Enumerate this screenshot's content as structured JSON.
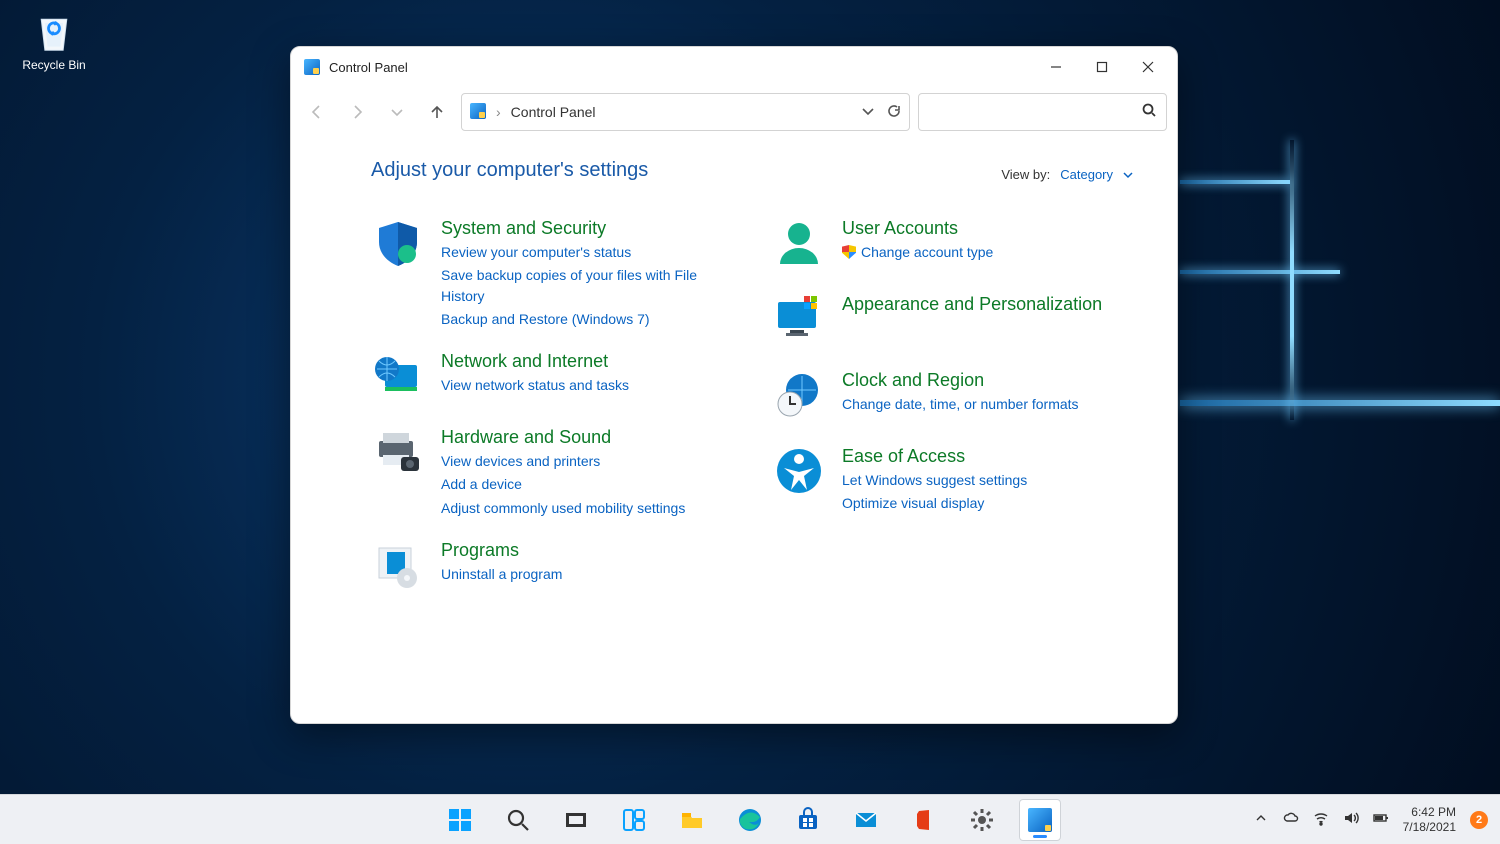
{
  "desktop": {
    "recycle_bin": "Recycle Bin"
  },
  "window": {
    "title": "Control Panel",
    "breadcrumb": "Control Panel",
    "search_placeholder": ""
  },
  "main": {
    "heading": "Adjust your computer's settings",
    "viewby_label": "View by:",
    "viewby_value": "Category"
  },
  "categories": {
    "left": [
      {
        "title": "System and Security",
        "links": [
          "Review your computer's status",
          "Save backup copies of your files with File History",
          "Backup and Restore (Windows 7)"
        ]
      },
      {
        "title": "Network and Internet",
        "links": [
          "View network status and tasks"
        ]
      },
      {
        "title": "Hardware and Sound",
        "links": [
          "View devices and printers",
          "Add a device",
          "Adjust commonly used mobility settings"
        ]
      },
      {
        "title": "Programs",
        "links": [
          "Uninstall a program"
        ]
      }
    ],
    "right": [
      {
        "title": "User Accounts",
        "links": [
          "Change account type"
        ],
        "shield": [
          true
        ]
      },
      {
        "title": "Appearance and Personalization",
        "links": []
      },
      {
        "title": "Clock and Region",
        "links": [
          "Change date, time, or number formats"
        ]
      },
      {
        "title": "Ease of Access",
        "links": [
          "Let Windows suggest settings",
          "Optimize visual display"
        ]
      }
    ]
  },
  "taskbar": {
    "time": "6:42 PM",
    "date": "7/18/2021",
    "notification_count": "2"
  }
}
